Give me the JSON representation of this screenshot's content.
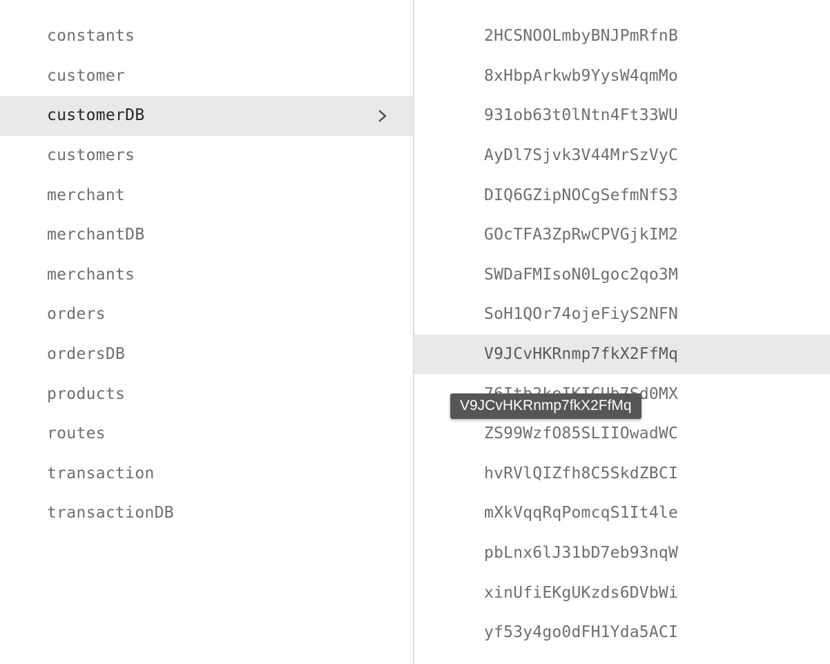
{
  "left_panel": {
    "items": [
      {
        "label": "constants",
        "selected": false,
        "has_chevron": false
      },
      {
        "label": "customer",
        "selected": false,
        "has_chevron": false
      },
      {
        "label": "customerDB",
        "selected": true,
        "has_chevron": true
      },
      {
        "label": "customers",
        "selected": false,
        "has_chevron": false
      },
      {
        "label": "merchant",
        "selected": false,
        "has_chevron": false
      },
      {
        "label": "merchantDB",
        "selected": false,
        "has_chevron": false
      },
      {
        "label": "merchants",
        "selected": false,
        "has_chevron": false
      },
      {
        "label": "orders",
        "selected": false,
        "has_chevron": false
      },
      {
        "label": "ordersDB",
        "selected": false,
        "has_chevron": false
      },
      {
        "label": "products",
        "selected": false,
        "has_chevron": false
      },
      {
        "label": "routes",
        "selected": false,
        "has_chevron": false
      },
      {
        "label": "transaction",
        "selected": false,
        "has_chevron": false
      },
      {
        "label": "transactionDB",
        "selected": false,
        "has_chevron": false
      }
    ],
    "chevron_icon": "chevron-right-icon"
  },
  "right_panel": {
    "items": [
      {
        "label": "2HCSNOOLmbyBNJPmRfnB",
        "highlighted": false
      },
      {
        "label": "8xHbpArkwb9YysW4qmMo",
        "highlighted": false
      },
      {
        "label": "931ob63t0lNtn4Ft33WU",
        "highlighted": false
      },
      {
        "label": "AyDl7Sjvk3V44MrSzVyC",
        "highlighted": false
      },
      {
        "label": "DIQ6GZipNOCgSefmNfS3",
        "highlighted": false
      },
      {
        "label": "GOcTFA3ZpRwCPVGjkIM2",
        "highlighted": false
      },
      {
        "label": "SWDaFMIsoN0Lgoc2qo3M",
        "highlighted": false
      },
      {
        "label": "SoH1QOr74ojeFiyS2NFN",
        "highlighted": false
      },
      {
        "label": "V9JCvHKRnmp7fkX2FfMq",
        "highlighted": true
      },
      {
        "label": "76Itb2keIKICUb7Sd0MX",
        "highlighted": false
      },
      {
        "label": "ZS99WzfO85SLIIOwadWC",
        "highlighted": false
      },
      {
        "label": "hvRVlQIZfh8C5SkdZBCI",
        "highlighted": false
      },
      {
        "label": "mXkVqqRqPomcqS1It4le",
        "highlighted": false
      },
      {
        "label": "pbLnx6lJ31bD7eb93nqW",
        "highlighted": false
      },
      {
        "label": "xinUfiEKgUKzds6DVbWi",
        "highlighted": false
      },
      {
        "label": "yf53y4go0dFH1Yda5ACI",
        "highlighted": false
      }
    ]
  },
  "tooltip": {
    "text": "V9JCvHKRnmp7fkX2FfMq"
  },
  "colors": {
    "background": "#ffffff",
    "item_text": "#6e6e6e",
    "selected_text": "#252525",
    "highlight_background": "#e9e9e9",
    "divider": "#dcdcdc",
    "tooltip_background": "#565656",
    "tooltip_text": "#ffffff"
  }
}
